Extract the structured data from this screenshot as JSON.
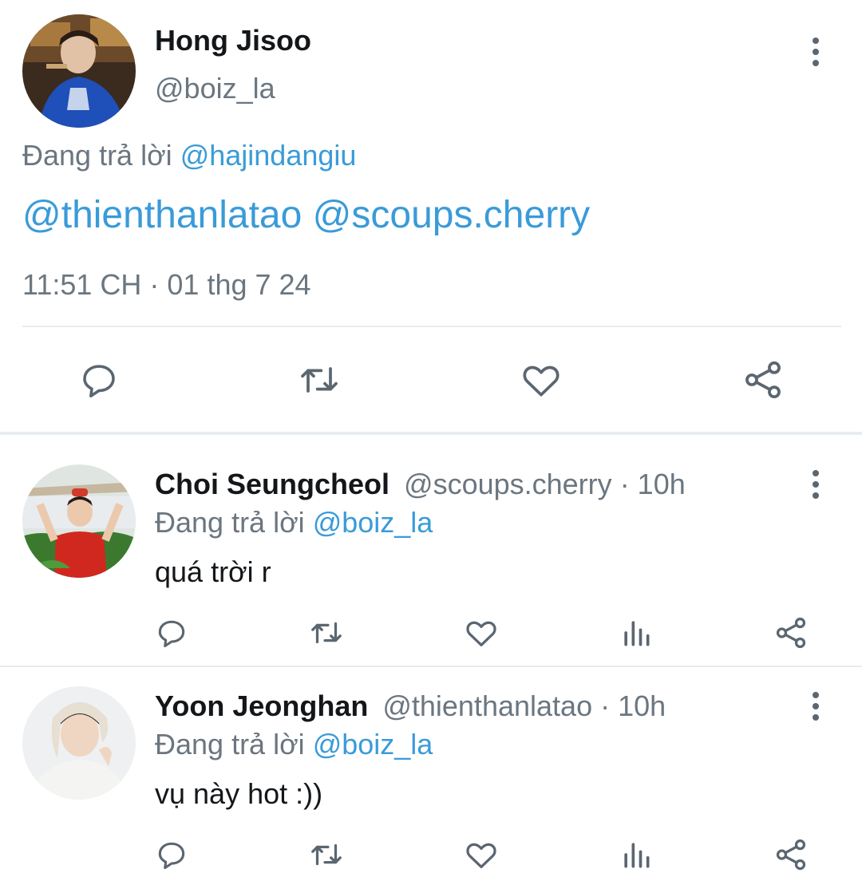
{
  "main_tweet": {
    "author_name": "Hong Jisoo",
    "author_handle": "@boiz_la",
    "reply_prefix": "Đang trả lời",
    "reply_to": "@hajindangiu",
    "text": "@thienthanlatao @scoups.cherry",
    "timestamp": "11:51 CH · 01 thg 7 24",
    "actions": [
      "reply-icon",
      "retweet-icon",
      "like-icon",
      "share-icon"
    ]
  },
  "replies": [
    {
      "author_name": "Choi Seungcheol",
      "author_handle": "@scoups.cherry",
      "time": "· 10h",
      "reply_prefix": "Đang trả lời",
      "reply_to": "@boiz_la",
      "text": "quá trời r"
    },
    {
      "author_name": "Yoon Jeonghan",
      "author_handle": "@thienthanlatao",
      "time": "· 10h",
      "reply_prefix": "Đang trả lời",
      "reply_to": "@boiz_la",
      "text": "vụ này hot :))"
    }
  ],
  "colors": {
    "link": "#3a9bd8",
    "muted": "#6b7680",
    "icon": "#5b6670",
    "divider": "#e6ecf0"
  }
}
